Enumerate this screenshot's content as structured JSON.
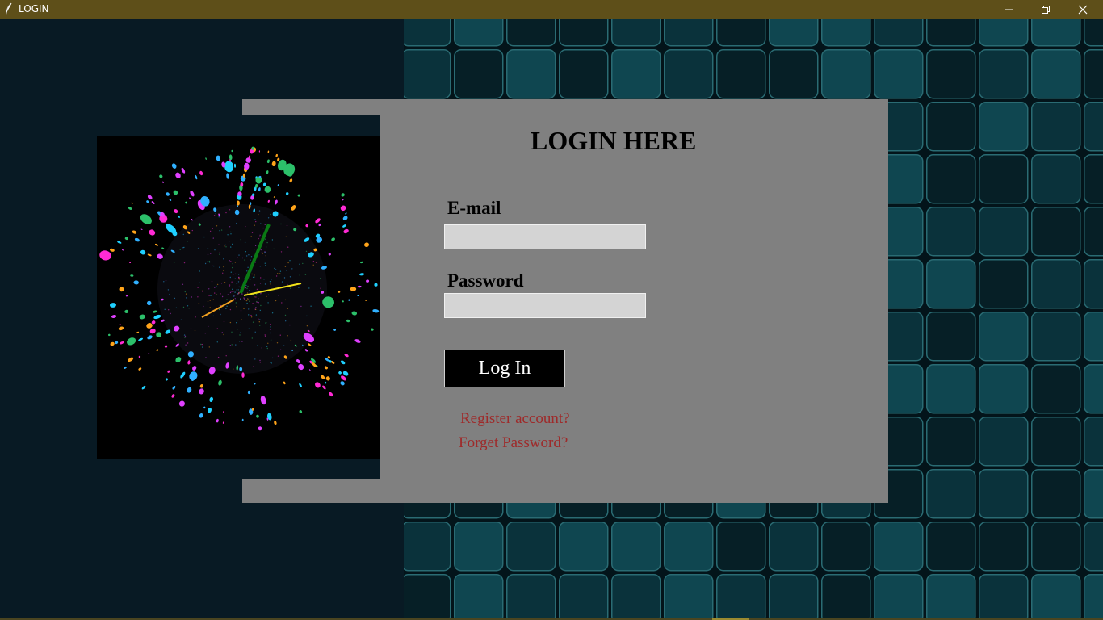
{
  "window": {
    "title": "LOGIN",
    "icons": {
      "app": "feather-icon",
      "minimize": "minimize-icon",
      "restore": "restore-icon",
      "close": "close-icon"
    },
    "titlebar_color": "#5e4f19"
  },
  "form": {
    "heading": "LOGIN HERE",
    "email_label": "E-mail",
    "email_value": "",
    "password_label": "Password",
    "password_value": "",
    "login_button": "Log In",
    "register_link": "Register account?",
    "forgot_link": "Forget Password?"
  },
  "clock": {
    "hands": {
      "hour": "orange",
      "minute": "green",
      "second": "yellow"
    }
  },
  "colors": {
    "panel": "#808080",
    "background_dark": "#081a24",
    "input_bg": "#d4d4d4",
    "button_bg": "#000000",
    "link": "#9e2a2a",
    "tile": "#0f4650"
  }
}
